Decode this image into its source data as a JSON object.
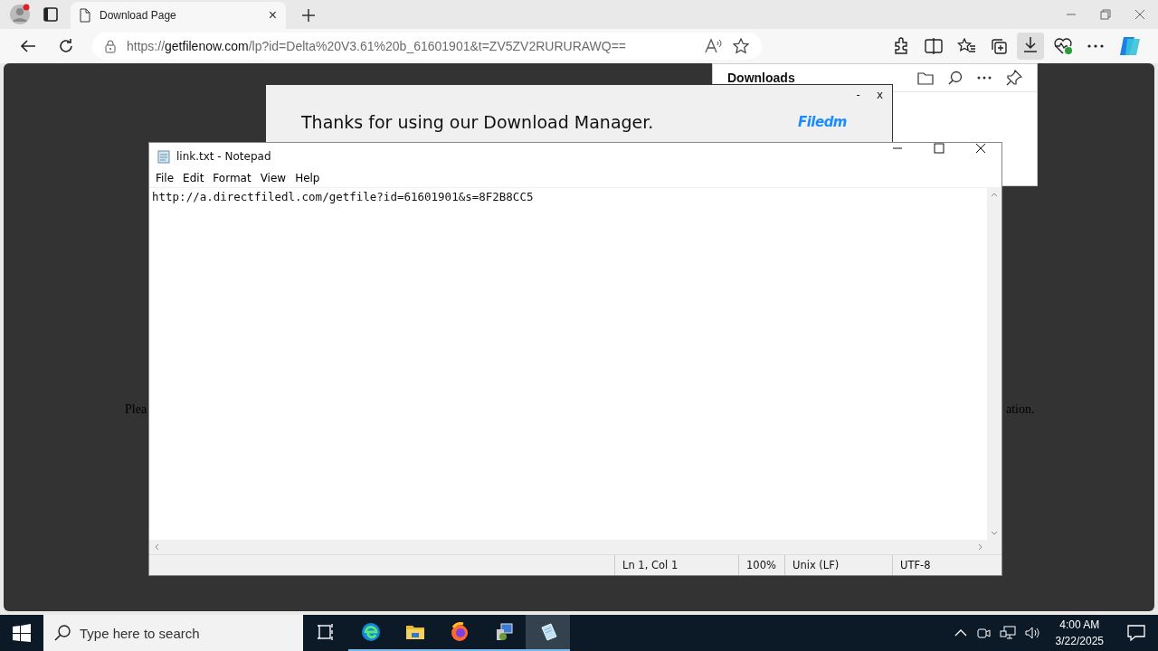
{
  "browser": {
    "tabs": [
      {
        "title": "Download Page",
        "close": "×",
        "selected": true
      }
    ],
    "address": {
      "scheme": "https://",
      "domain": "getfilenow.com",
      "path": "/lp?id=Delta%20V3.61%20b_61601901&t=ZV5ZV2RURURAWQ=="
    },
    "page": {
      "text_left": "Plea",
      "text_right": "ation."
    }
  },
  "popup": {
    "minimize": "-",
    "close": "x",
    "message": "Thanks for using our Download Manager.",
    "logo": "Filedm"
  },
  "downloads_panel": {
    "title": "Downloads"
  },
  "notepad": {
    "title": "link.txt - Notepad",
    "menu": [
      "File",
      "Edit",
      "Format",
      "View",
      "Help"
    ],
    "content": "http://a.directfiledl.com/getfile?id=61601901&s=8F2B8CC5",
    "status": [
      "Ln 1, Col 1",
      "100%",
      "Unix (LF)",
      "UTF-8"
    ]
  },
  "taskbar": {
    "search_placeholder": "Type here to search",
    "apps": [
      {
        "kind": "taskview",
        "running": false,
        "selected": false
      },
      {
        "kind": "edge",
        "running": true,
        "selected": false
      },
      {
        "kind": "explorer",
        "running": true,
        "selected": false
      },
      {
        "kind": "firefox",
        "running": true,
        "selected": false
      },
      {
        "kind": "installer",
        "running": true,
        "selected": false
      },
      {
        "kind": "notepad",
        "running": true,
        "selected": true
      }
    ],
    "time": "4:00 AM",
    "date": "3/22/2025"
  }
}
